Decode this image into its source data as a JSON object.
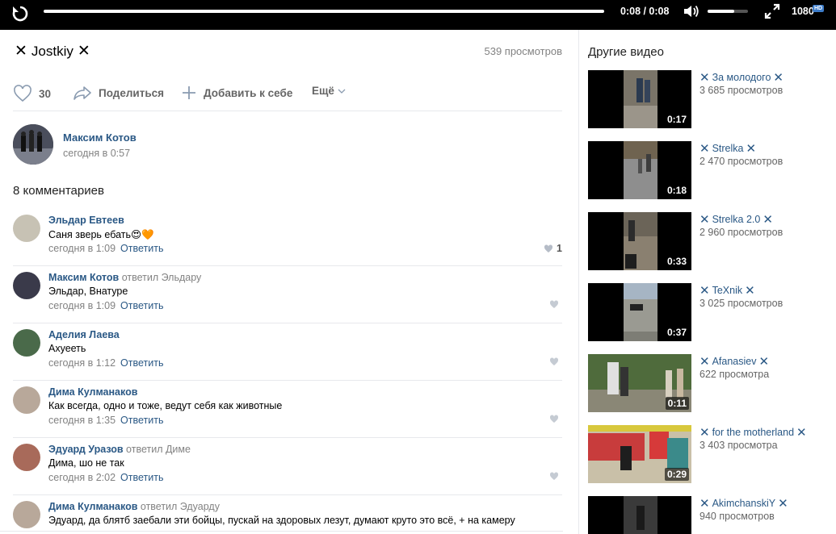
{
  "player": {
    "time": "0:08 / 0:08",
    "quality": "1080",
    "hd_badge": "HD",
    "volume_fraction": 0.66
  },
  "video": {
    "title_prefix": "✕",
    "title": "Jostkiy",
    "title_suffix": "✕",
    "views": "539 просмотров"
  },
  "actions": {
    "likes": "30",
    "share_label": "Поделиться",
    "add_label": "Добавить к себе",
    "more_label": "Ещё"
  },
  "author": {
    "name": "Максим Котов",
    "date": "сегодня в 0:57"
  },
  "comments_count": "8 комментариев",
  "comments": [
    {
      "name": "Эльдар Евтеев",
      "reply": "",
      "text": "Саня зверь ебать😍🧡",
      "date": "сегодня в 1:09",
      "reply_label": "Ответить",
      "likes": "1",
      "avatar_color": "#c7c2b4"
    },
    {
      "name": "Максим Котов",
      "reply": "ответил Эльдару",
      "text": "Эльдар, Внатуре",
      "date": "сегодня в 1:09",
      "reply_label": "Ответить",
      "likes": "",
      "avatar_color": "#3a3a4a"
    },
    {
      "name": "Аделия Лаева",
      "reply": "",
      "text": "Ахуееть",
      "date": "сегодня в 1:12",
      "reply_label": "Ответить",
      "likes": "",
      "avatar_color": "#4a6a4a"
    },
    {
      "name": "Дима Кулманаков",
      "reply": "",
      "text": "Как всегда, одно и тоже, ведут себя как животные",
      "date": "сегодня в 1:35",
      "reply_label": "Ответить",
      "likes": "",
      "avatar_color": "#b8a89a"
    },
    {
      "name": "Эдуард Уразов",
      "reply": "ответил Диме",
      "text": "Дима, шо не так",
      "date": "сегодня в 2:02",
      "reply_label": "Ответить",
      "likes": "",
      "avatar_color": "#a86a5a"
    },
    {
      "name": "Дима Кулманаков",
      "reply": "ответил Эдуарду",
      "text": "Эдуард, да блятб заебали эти бойцы, пускай на здоровых лезут, думают круто это всё, + на камеру",
      "date": "",
      "reply_label": "",
      "likes": "",
      "avatar_color": "#b8a89a"
    }
  ],
  "sidebar": {
    "title": "Другие видео",
    "videos": [
      {
        "title": "За молодого",
        "views": "3 685 просмотров",
        "duration": "0:17"
      },
      {
        "title": "Strelka",
        "views": "2 470 просмотров",
        "duration": "0:18"
      },
      {
        "title": "Strelka 2.0",
        "views": "2 960 просмотров",
        "duration": "0:33"
      },
      {
        "title": "TeXnik",
        "views": "3 025 просмотров",
        "duration": "0:37"
      },
      {
        "title": "Afanasiev",
        "views": "622 просмотра",
        "duration": "0:11"
      },
      {
        "title": "for the motherland",
        "views": "3 403 просмотра",
        "duration": "0:29"
      },
      {
        "title": "AkimchanskiY",
        "views": "940 просмотров",
        "duration": ""
      }
    ]
  },
  "colors": {
    "link": "#2a5885",
    "muted": "#828282",
    "accent_hd": "#3d7cc9"
  }
}
